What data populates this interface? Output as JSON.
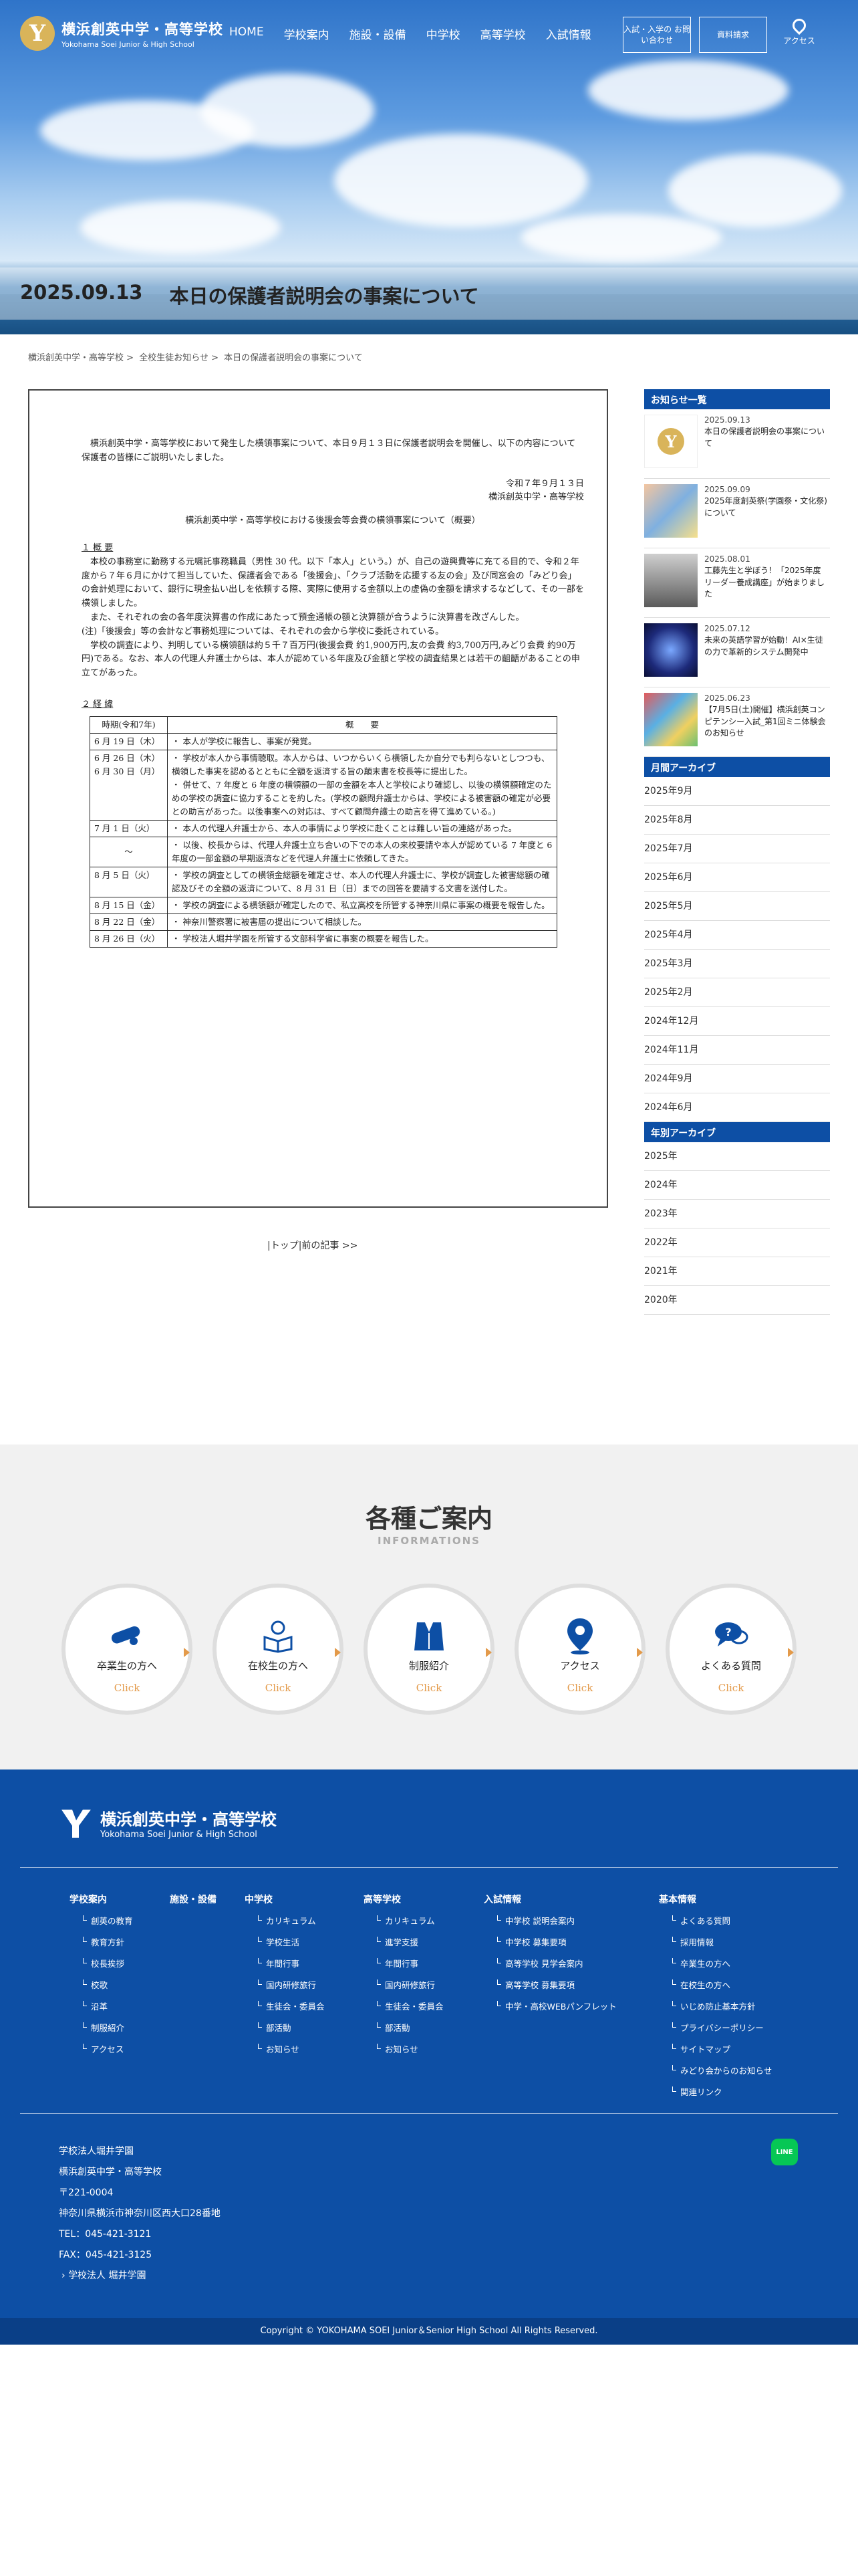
{
  "header": {
    "logo_jp": "横浜創英中学・高等学校",
    "logo_en": "Yokohama Soei Junior & High School",
    "nav": [
      "HOME",
      "学校案内",
      "施設・設備",
      "中学校",
      "高等学校",
      "入試情報"
    ],
    "btn_inquiry": "入試・入学の お問い合わせ",
    "btn_brochure": "資料請求",
    "access": "アクセス"
  },
  "hero": {
    "date": "2025.09.13",
    "title": "本日の保護者説明会の事案について"
  },
  "breadcrumb": [
    "横浜創英中学・高等学校",
    ">",
    "全校生徒お知らせ",
    ">",
    "本日の保護者説明会の事案について"
  ],
  "doc": {
    "intro": "横浜創英中学・高等学校において発生した横領事案について、本日９月１３日に保護者説明会を開催し、以下の内容について保護者の皆様にご説明いたしました。",
    "date": "令和７年９月１３日",
    "school": "横浜創英中学・高等学校",
    "subject": "横浜創英中学・高等学校における後援会等会費の横領事案について（概要）",
    "s1": "１ 概 要",
    "p1": "本校の事務室に勤務する元嘱託事務職員（男性 30 代。以下「本人」という。）が、自己の遊興費等に充てる目的で、令和２年度から７年６月にかけて担当していた、保護者会である「後援会」、「クラブ活動を応援する友の会」及び同窓会の「みどり会」の会計処理において、銀行に現金払い出しを依頼する際、実際に使用する金額以上の虚偽の金額を請求するなどして、その一部を横領しました。",
    "p2": "また、それぞれの会の各年度決算書の作成にあたって預金通帳の額と決算額が合うように決算書を改ざんした。",
    "p3": "(注)「後援会」等の会計など事務処理については、それぞれの会から学校に委託されている。",
    "p4": "学校の調査により、判明している横領額は約５千７百万円(後援会費 約1,900万円,友の会費 約3,700万円,みどり会費 約90万円)である。なお、本人の代理人弁護士からは、本人が認めている年度及び金額と学校の調査結果とは若干の齟齬があることの申立てがあった。",
    "s2": "２ 経 緯",
    "table_head": [
      "時期(令和7年)",
      "概　　要"
    ],
    "rows": [
      {
        "d": "6 月 19 日（木）",
        "t": "・ 本人が学校に報告し、事案が発覚。"
      },
      {
        "d": "6 月 26 日（木）\n6 月 30 日（月）",
        "t": "・ 学校が本人から事情聴取。本人からは、いつからいくら横領したか自分でも判らないとしつつも、横領した事実を認めるとともに全額を返済する旨の顛末書を校長等に提出した。\n・ 併せて、7 年度と 6 年度の横領額の一部の金額を本人と学校により確認し、以後の横領額確定のための学校の調査に協力することを約した。(学校の顧問弁護士からは、学校による被害額の確定が必要との助言があった。以後事案への対応は、すべて顧問弁護士の助言を得て進めている。)"
      },
      {
        "d": "7 月 1 日（火）",
        "t": "・ 本人の代理人弁護士から、本人の事情により学校に赴くことは難しい旨の連絡があった。"
      },
      {
        "d": "～",
        "t": "・ 以後、校長からは、代理人弁護士立ち合いの下での本人の来校要請や本人が認めている 7 年度と 6 年度の一部金額の早期返済などを代理人弁護士に依頼してきた。"
      },
      {
        "d": "8 月 5 日（火）",
        "t": "・ 学校の調査としての横領金総額を確定させ、本人の代理人弁護士に、学校が調査した被害総額の確認及びその全額の返済について、8 月 31 日（日）までの回答を要請する文書を送付した。"
      },
      {
        "d": "8 月 15 日（金）",
        "t": "・ 学校の調査による横領額が確定したので、私立高校を所管する神奈川県に事案の概要を報告した。"
      },
      {
        "d": "8 月 22 日（金）",
        "t": "・ 神奈川警察署に被害届の提出について相談した。"
      },
      {
        "d": "8 月 26 日（火）",
        "t": "・ 学校法人堀井学園を所管する文部科学省に事案の概要を報告した。"
      }
    ]
  },
  "pager": "|トップ|前の記事 >>",
  "sidebar": {
    "news_heading": "お知らせ一覧",
    "news": [
      {
        "date": "2025.09.13",
        "title": "本日の保護者説明会の事案について"
      },
      {
        "date": "2025.09.09",
        "title": "2025年度創英祭(学園祭・文化祭)について"
      },
      {
        "date": "2025.08.01",
        "title": "工藤先生と学ぼう！「2025年度 リーダー養成講座」が始まりました"
      },
      {
        "date": "2025.07.12",
        "title": "未来の英語学習が始動！AI×生徒の力で革新的システム開発中"
      },
      {
        "date": "2025.06.23",
        "title": "【7月5日(土)開催】横浜創英コンピテンシー入試_第1回ミニ体験会のお知らせ"
      }
    ],
    "monthly_heading": "月間アーカイブ",
    "monthly": [
      "2025年9月",
      "2025年8月",
      "2025年7月",
      "2025年6月",
      "2025年5月",
      "2025年4月",
      "2025年3月",
      "2025年2月",
      "2024年12月",
      "2024年11月",
      "2024年9月",
      "2024年6月"
    ],
    "yearly_heading": "年別アーカイブ",
    "yearly": [
      "2025年",
      "2024年",
      "2023年",
      "2022年",
      "2021年",
      "2020年"
    ]
  },
  "info": {
    "title": "各種ご案内",
    "subtitle": "INFORMATIONS",
    "click": "Click",
    "items": [
      "卒業生の方へ",
      "在校生の方へ",
      "制服紹介",
      "アクセス",
      "よくある質問"
    ]
  },
  "footer": {
    "logo_jp": "横浜創英中学・高等学校",
    "logo_en": "Yokohama Soei Junior & High School",
    "cols": [
      {
        "h": "学校案内",
        "items": [
          "創英の教育",
          "教育方針",
          "校長挨拶",
          "校歌",
          "沿革",
          "制服紹介",
          "アクセス"
        ]
      },
      {
        "h": "施設・設備",
        "items": []
      },
      {
        "h": "中学校",
        "items": [
          "カリキュラム",
          "学校生活",
          "年間行事",
          "国内研修旅行",
          "生徒会・委員会",
          "部活動",
          "お知らせ"
        ]
      },
      {
        "h": "高等学校",
        "items": [
          "カリキュラム",
          "進学支援",
          "年間行事",
          "国内研修旅行",
          "生徒会・委員会",
          "部活動",
          "お知らせ"
        ]
      },
      {
        "h": "入試情報",
        "items": [
          "中学校 説明会案内",
          "中学校 募集要項",
          "高等学校 見学会案内",
          "高等学校 募集要項",
          "中学・高校WEBパンフレット"
        ]
      },
      {
        "h": "基本情報",
        "items": [
          "よくある質問",
          "採用情報",
          "卒業生の方へ",
          "在校生の方へ",
          "いじめ防止基本方針",
          "プライバシーポリシー",
          "サイトマップ",
          "みどり会からのお知らせ",
          "関連リンク"
        ]
      }
    ],
    "addr": [
      "学校法人堀井学園",
      "横浜創英中学・高等学校",
      "〒221-0004",
      "神奈川県横浜市神奈川区西大口28番地",
      "TEL：045-421-3121",
      "FAX：045-421-3125"
    ],
    "corp_link": "学校法人 堀井学園",
    "line": "LINE",
    "copyright": "Copyright © YOKOHAMA SOEI Junior＆Senior High School All Rights Reserved."
  }
}
